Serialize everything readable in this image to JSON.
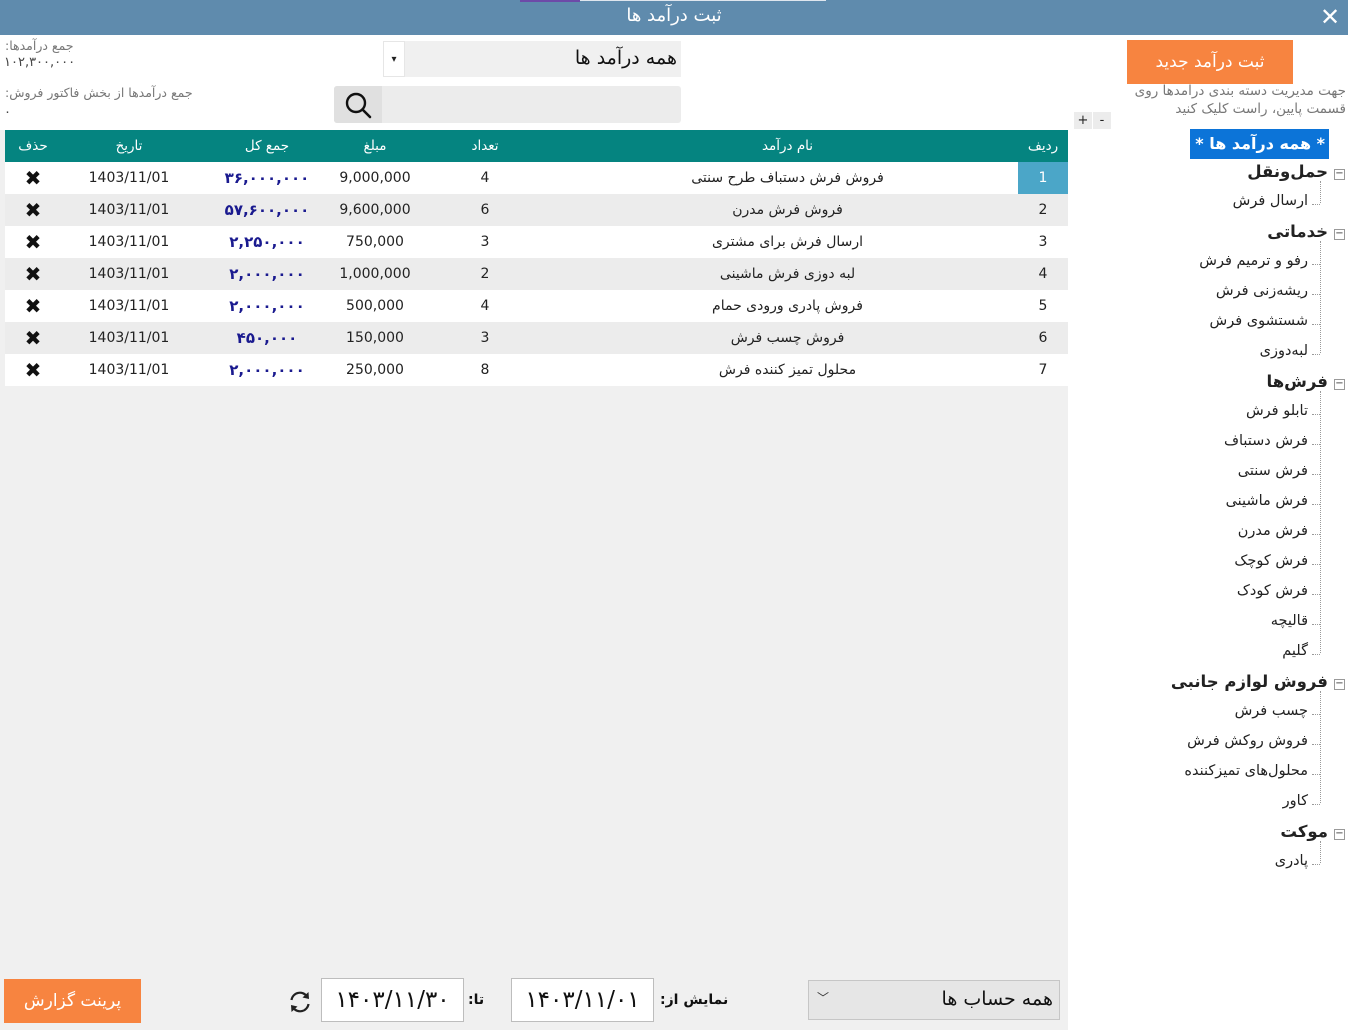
{
  "window": {
    "title": "ثبت درآمد ها",
    "close_glyph": "✕"
  },
  "summary": {
    "total_label": "جمع درآمدها:",
    "total_value": "۱۰۲,۳۰۰,۰۰۰",
    "sales_label": "جمع درآمدها از بخش فاکتور فروش:",
    "sales_value": "۰"
  },
  "filter": {
    "category_value": "همه درآمد ها",
    "search_placeholder": ""
  },
  "grid": {
    "headers": {
      "del": "حذف",
      "date": "تاریخ",
      "total": "جمع کل",
      "amount": "مبلغ",
      "count": "تعداد",
      "name": "نام درآمد",
      "row": "ردیف"
    },
    "rows": [
      {
        "row": "1",
        "name": "فروش فرش دستباف طرح سنتی",
        "count": "4",
        "amount": "9,000,000",
        "total": "۳۶,۰۰۰,۰۰۰",
        "date": "1403/11/01"
      },
      {
        "row": "2",
        "name": "فروش فرش مدرن",
        "count": "6",
        "amount": "9,600,000",
        "total": "۵۷,۶۰۰,۰۰۰",
        "date": "1403/11/01"
      },
      {
        "row": "3",
        "name": "ارسال فرش برای مشتری",
        "count": "3",
        "amount": "750,000",
        "total": "۲,۲۵۰,۰۰۰",
        "date": "1403/11/01"
      },
      {
        "row": "4",
        "name": "لبه دوزی فرش ماشینی",
        "count": "2",
        "amount": "1,000,000",
        "total": "۲,۰۰۰,۰۰۰",
        "date": "1403/11/01"
      },
      {
        "row": "5",
        "name": "فروش پادری ورودی حمام",
        "count": "4",
        "amount": "500,000",
        "total": "۲,۰۰۰,۰۰۰",
        "date": "1403/11/01"
      },
      {
        "row": "6",
        "name": "فروش چسب فرش",
        "count": "3",
        "amount": "150,000",
        "total": "۴۵۰,۰۰۰",
        "date": "1403/11/01"
      },
      {
        "row": "7",
        "name": "محلول تمیز کننده فرش",
        "count": "8",
        "amount": "250,000",
        "total": "۲,۰۰۰,۰۰۰",
        "date": "1403/11/01"
      }
    ],
    "delete_glyph": "✖"
  },
  "sidebar": {
    "new_button": "ثبت درآمد جدید",
    "hint": "جهت مدیریت دسته بندی درامدها روی قسمت پایین، راست کلیک کنید",
    "plus": "+",
    "minus": "-",
    "expander_glyph": "−",
    "root": "* همه درآمد ها *",
    "groups": [
      {
        "label": "حمل‌ونقل",
        "items": [
          "ارسال فرش"
        ]
      },
      {
        "label": "خدماتی",
        "items": [
          "رفو و ترمیم فرش",
          "ریشه‌زنی فرش",
          "شستشوی فرش",
          "لبه‌دوزی"
        ]
      },
      {
        "label": "فرش‌ها",
        "items": [
          "تابلو فرش",
          "فرش دستباف",
          "فرش سنتی",
          "فرش ماشینی",
          "فرش مدرن",
          "فرش کوچک",
          "فرش کودک",
          "قالیچه",
          "گلیم"
        ]
      },
      {
        "label": "فروش لوازم جانبی",
        "items": [
          "چسب فرش",
          "فروش روکش فرش",
          "محلول‌های تمیزکننده",
          "کاور"
        ]
      },
      {
        "label": "موکت",
        "items": [
          "پادری"
        ]
      }
    ]
  },
  "bottom": {
    "print_button": "پرینت گزارش",
    "refresh_icon": "refresh-icon",
    "to_label": "تا:",
    "to_value": "۱۴۰۳/۱۱/۳۰",
    "from_label": "نمایش از:",
    "from_value": "۱۴۰۳/۱۱/۰۱",
    "accounts_value": "همه حساب ها",
    "accounts_arrow": "﹀"
  },
  "colors": {
    "titlebar": "#5f8bad",
    "accent_orange": "#f78440",
    "grid_header": "#058480",
    "tree_selected": "#0c74d8",
    "row_selected": "#4ba6c8"
  }
}
